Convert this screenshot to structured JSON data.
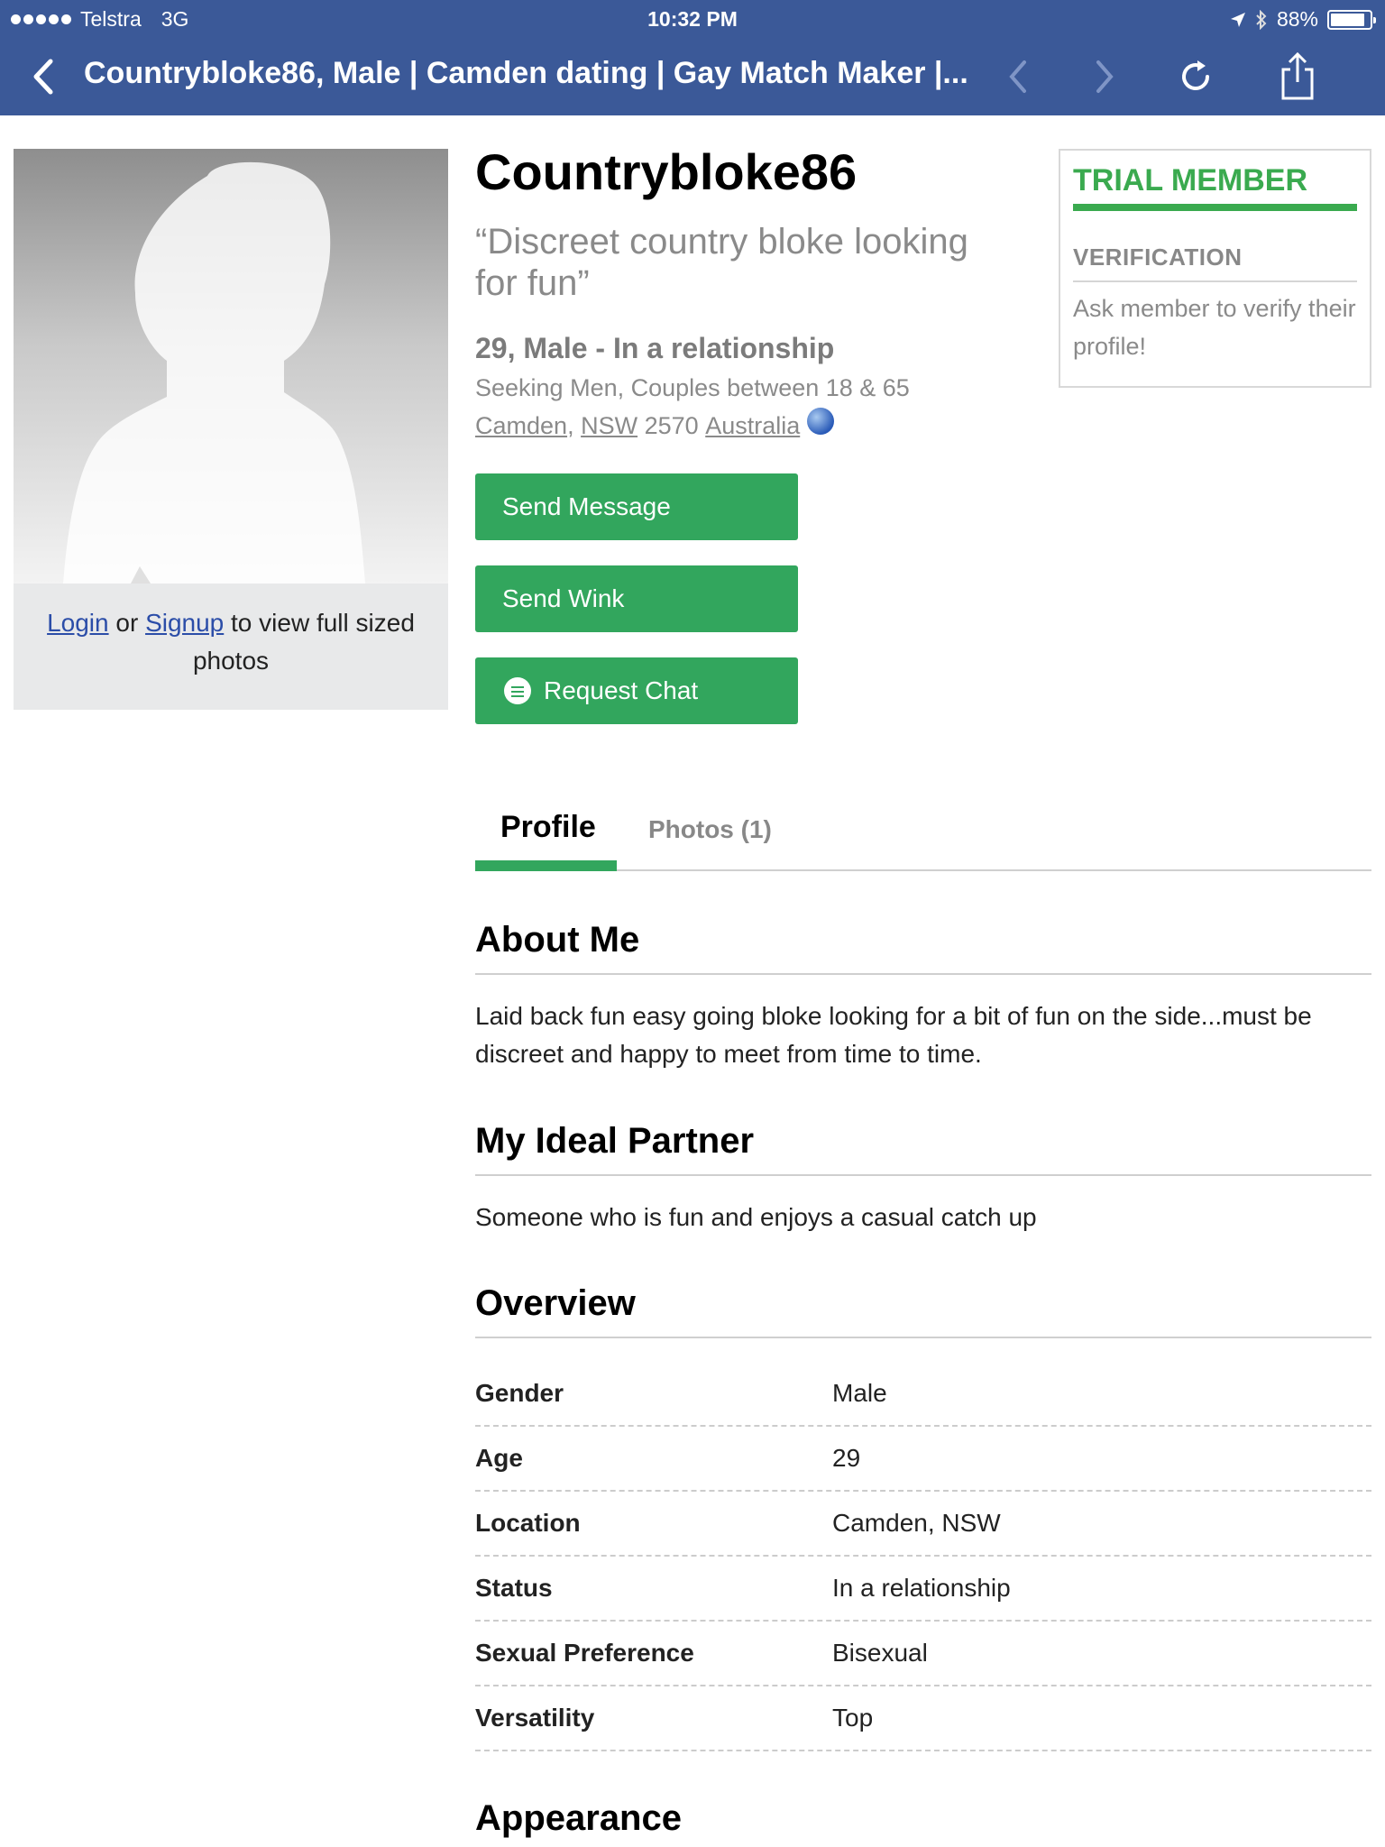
{
  "status_bar": {
    "carrier": "Telstra",
    "network": "3G",
    "time": "10:32 PM",
    "battery": "88%",
    "battery_level": 0.88
  },
  "nav": {
    "title": "Countrybloke86, Male | Camden dating | Gay Match Maker |...",
    "icons": [
      "back-chevron-icon",
      "prev-arrow-icon",
      "next-arrow-icon",
      "reload-icon",
      "share-icon"
    ]
  },
  "photo_card": {
    "login_label": "Login",
    "or_text": "or",
    "signup_label": "Signup",
    "caption_rest": "to view full sized photos"
  },
  "profile": {
    "username": "Countrybloke86",
    "tagline": "“Discreet country bloke looking for fun”",
    "basic": "29, Male - In a relationship",
    "seeking": "Seeking Men, Couples between 18 & 65",
    "location": {
      "suburb": "Camden",
      "state": "NSW",
      "postcode": "2570",
      "country": "Australia"
    }
  },
  "buttons": {
    "send_message": "Send Message",
    "send_wink": "Send Wink",
    "request_chat": "Request Chat"
  },
  "trial_box": {
    "title": "TRIAL MEMBER",
    "verification_label": "VERIFICATION",
    "verification_text": "Ask member to verify their profile!"
  },
  "tabs": {
    "profile": "Profile",
    "photos": "Photos (1)"
  },
  "sections": {
    "about_me": {
      "heading": "About Me",
      "text": "Laid back fun easy going bloke looking for a bit of fun on the side...must be discreet and happy to meet from time to time."
    },
    "ideal_partner": {
      "heading": "My Ideal Partner",
      "text": "Someone who is fun and enjoys a casual catch up"
    },
    "overview": {
      "heading": "Overview",
      "rows": [
        {
          "label": "Gender",
          "value": "Male"
        },
        {
          "label": "Age",
          "value": "29"
        },
        {
          "label": "Location",
          "value": "Camden, NSW"
        },
        {
          "label": "Status",
          "value": "In a relationship"
        },
        {
          "label": "Sexual Preference",
          "value": "Bisexual"
        },
        {
          "label": "Versatility",
          "value": "Top"
        }
      ]
    },
    "appearance": {
      "heading": "Appearance"
    }
  },
  "colors": {
    "nav_bg": "#3b5998",
    "button_green": "#32a65d",
    "trial_green": "#3aaa4f",
    "link_blue": "#2b4da8"
  }
}
